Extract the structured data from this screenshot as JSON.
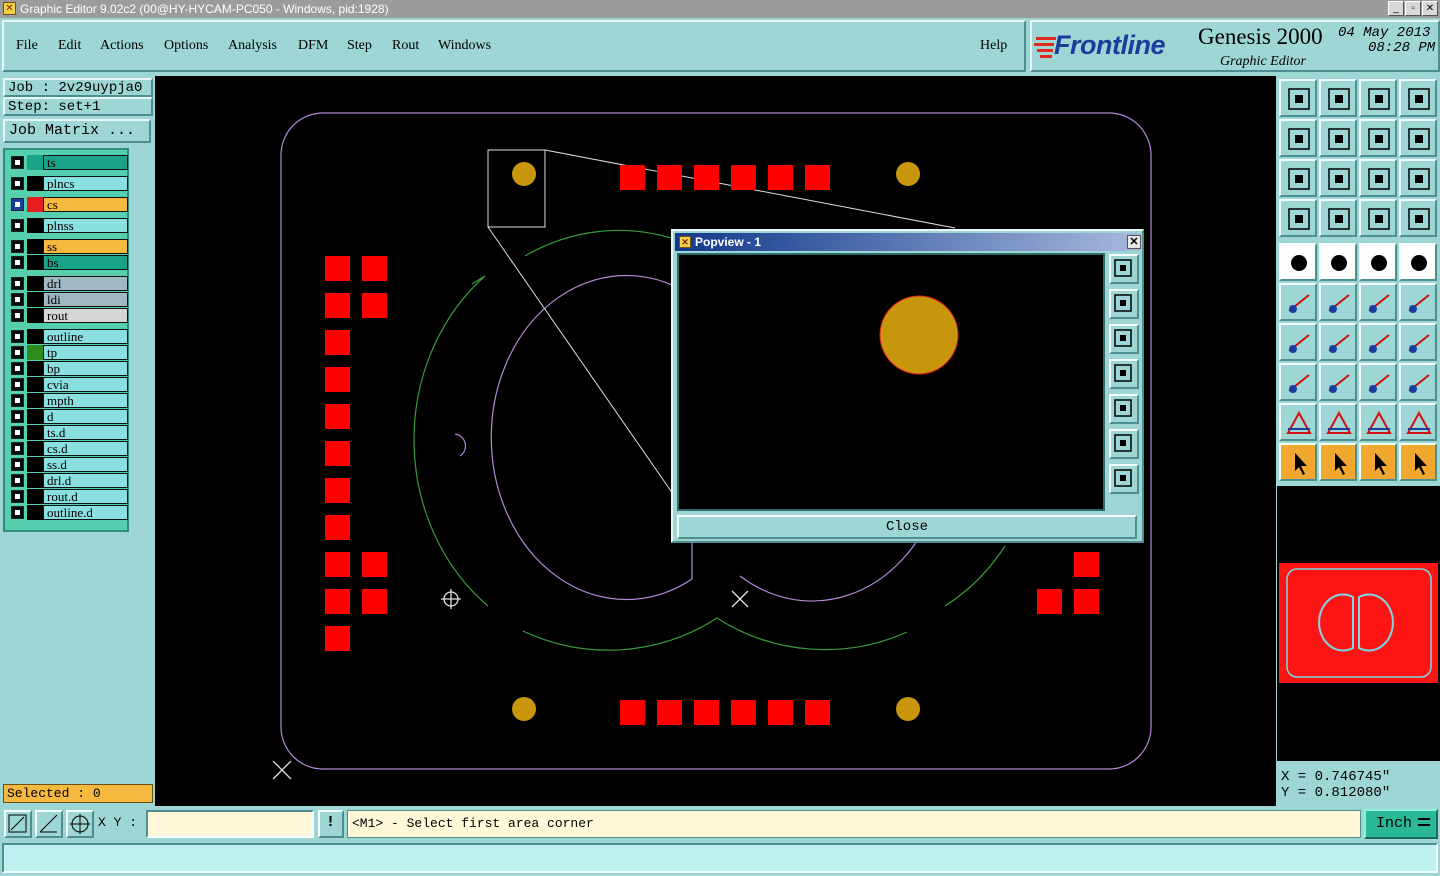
{
  "window": {
    "title": "Graphic Editor 9.02c2 (00@HY-HYCAM-PC050 - Windows, pid:1928)"
  },
  "menu": {
    "items": [
      "File",
      "Edit",
      "Actions",
      "Options",
      "Analysis",
      "DFM",
      "Step",
      "Rout",
      "Windows"
    ],
    "help": "Help"
  },
  "header": {
    "brand": "Frontline",
    "product": "Genesis 2000",
    "subtitle": "Graphic Editor",
    "date": "04 May 2013",
    "time": "08:28 PM"
  },
  "job": {
    "job_label": "Job : 2v29uypja0",
    "step_label": "Step: set+1",
    "matrix_button": "Job Matrix ..."
  },
  "layers": [
    {
      "name": "ts",
      "bg": "#1aa386",
      "swatch": "#1aa386"
    },
    {
      "name": "plncs",
      "bg": "#8ae0e0",
      "swatch": "#000000"
    },
    {
      "name": "cs",
      "bg": "#f6b940",
      "swatch": "#e81c1c",
      "active": true
    },
    {
      "name": "plnss",
      "bg": "#8ae0e0",
      "swatch": "#000000"
    },
    {
      "name": "ss",
      "bg": "#f6b940",
      "swatch": "#000000"
    },
    {
      "name": "bs",
      "bg": "#1aa386",
      "swatch": "#000000"
    },
    {
      "name": "drl",
      "bg": "#a0b8c4",
      "swatch": "#000000"
    },
    {
      "name": "ldi",
      "bg": "#a0b8c4",
      "swatch": "#000000"
    },
    {
      "name": "rout",
      "bg": "#d6d6d6",
      "swatch": "#000000"
    },
    {
      "name": "outline",
      "bg": "#8ae0e0",
      "swatch": "#000000"
    },
    {
      "name": "tp",
      "bg": "#8ae0e0",
      "swatch": "#2e8b1e"
    },
    {
      "name": "bp",
      "bg": "#8ae0e0",
      "swatch": "#000000"
    },
    {
      "name": "cvia",
      "bg": "#8ae0e0",
      "swatch": "#000000"
    },
    {
      "name": "mpth",
      "bg": "#8ae0e0",
      "swatch": "#000000"
    },
    {
      "name": "d",
      "bg": "#8ae0e0",
      "swatch": "#000000"
    },
    {
      "name": "ts.d",
      "bg": "#8ae0e0",
      "swatch": "#000000"
    },
    {
      "name": "cs.d",
      "bg": "#8ae0e0",
      "swatch": "#000000"
    },
    {
      "name": "ss.d",
      "bg": "#8ae0e0",
      "swatch": "#000000"
    },
    {
      "name": "drl.d",
      "bg": "#8ae0e0",
      "swatch": "#000000"
    },
    {
      "name": "rout.d",
      "bg": "#8ae0e0",
      "swatch": "#000000"
    },
    {
      "name": "outline.d",
      "bg": "#8ae0e0",
      "swatch": "#000000"
    }
  ],
  "selected": "Selected : 0",
  "popview": {
    "title": "Popview - 1",
    "close_label": "Close"
  },
  "coords": {
    "x": "X = 0.746745\"",
    "y": "Y = 0.812080\""
  },
  "statusbar": {
    "xy_label": "X Y :",
    "xy_value": "",
    "warn_glyph": "!",
    "message": "<M1> - Select first area corner",
    "unit": "Inch"
  },
  "colors": {
    "pad": "#ff0000",
    "drill": "#c8960c",
    "outline": "#b48ad8",
    "trace": "#3a9a3a",
    "panel": "#9ed6d6"
  }
}
